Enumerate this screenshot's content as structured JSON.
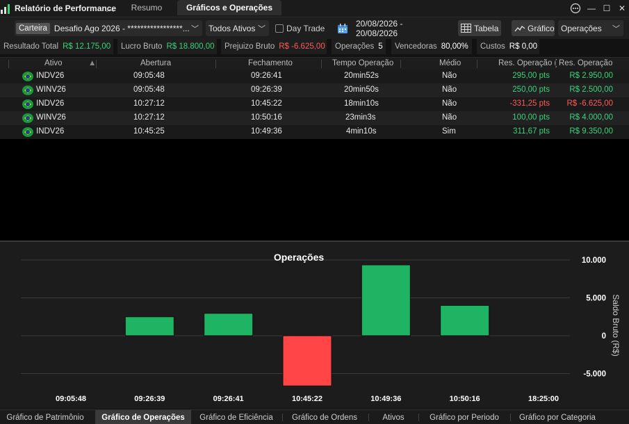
{
  "titlebar": {
    "app_title": "Relatório de Performance",
    "tabs": [
      {
        "label": "Resumo",
        "active": false
      },
      {
        "label": "Gráficos e Operações",
        "active": true
      }
    ],
    "menu_icon": "ellipsis-circle-icon",
    "minimize_icon": "minimize-icon",
    "maximize_icon": "maximize-icon",
    "close_icon": "close-icon"
  },
  "toolbar": {
    "carteira_label": "Carteira",
    "carteira_value": "Desafio Ago 2026 - *****************...",
    "ativos_value": "Todos Ativos",
    "daytrade_label": "Day Trade",
    "daytrade_checked": false,
    "date_range": "20/08/2026 - 20/08/2026",
    "tabela_label": "Tabela",
    "grafico_label": "Gráfico",
    "view_select_value": "Operações"
  },
  "stats": [
    {
      "label": "Resultado Total",
      "value": "R$ 12.175,00",
      "color": "#3dd17a"
    },
    {
      "label": "Lucro Bruto",
      "value": "R$ 18.800,00",
      "color": "#3dd17a"
    },
    {
      "label": "Prejuizo Bruto",
      "value": "R$ -6.625,00",
      "color": "#ff5a5a"
    },
    {
      "label": "Operações",
      "value": "5",
      "color": "#ffffff"
    },
    {
      "label": "Vencedoras",
      "value": "80,00%",
      "color": "#ffffff"
    },
    {
      "label": "Custos",
      "value": "R$ 0,00",
      "color": "#ffffff"
    }
  ],
  "table": {
    "headers": [
      "Ativo",
      "Abertura",
      "Fechamento",
      "Tempo Operação",
      "Médio",
      "Res. Operação (",
      "Res. Operação"
    ],
    "rows": [
      {
        "ativo": "INDV26",
        "abertura": "09:05:48",
        "fechamento": "09:26:41",
        "tempo": "20min52s",
        "medio": "Não",
        "res_pts": "295,00 pts",
        "res_brl": "R$ 2.950,00",
        "positive": true
      },
      {
        "ativo": "WINV26",
        "abertura": "09:05:48",
        "fechamento": "09:26:39",
        "tempo": "20min50s",
        "medio": "Não",
        "res_pts": "250,00 pts",
        "res_brl": "R$ 2.500,00",
        "positive": true
      },
      {
        "ativo": "INDV26",
        "abertura": "10:27:12",
        "fechamento": "10:45:22",
        "tempo": "18min10s",
        "medio": "Não",
        "res_pts": "-331,25 pts",
        "res_brl": "R$ -6.625,00",
        "positive": false
      },
      {
        "ativo": "WINV26",
        "abertura": "10:27:12",
        "fechamento": "10:50:16",
        "tempo": "23min3s",
        "medio": "Não",
        "res_pts": "100,00 pts",
        "res_brl": "R$ 4.000,00",
        "positive": true
      },
      {
        "ativo": "INDV26",
        "abertura": "10:45:25",
        "fechamento": "10:49:36",
        "tempo": "4min10s",
        "medio": "Sim",
        "res_pts": "311,67 pts",
        "res_brl": "R$ 9.350,00",
        "positive": true
      }
    ]
  },
  "chart_data": {
    "type": "bar",
    "title": "Operações",
    "ylabel": "Saldo Bruto (R$)",
    "xlabel": "",
    "x_tick_labels": [
      "09:05:48",
      "09:26:39",
      "09:26:41",
      "10:45:22",
      "10:49:36",
      "10:50:16",
      "18:25:00"
    ],
    "categories": [
      "09:26:39",
      "09:26:41",
      "10:45:22",
      "10:49:36",
      "10:50:16"
    ],
    "values": [
      2500,
      2950,
      -6625,
      9350,
      4000
    ],
    "y_tick_labels": [
      "10.000",
      "5.000",
      "0",
      "-5.000"
    ],
    "y_ticks": [
      10000,
      5000,
      0,
      -5000
    ],
    "ylim": [
      -6625,
      10000
    ],
    "positive_color": "#1fb463",
    "negative_color": "#ff4545",
    "grid": true
  },
  "bottom_tabs": [
    {
      "label": "Gráfico de Patrimônio",
      "active": false
    },
    {
      "label": "Gráfico de Operações",
      "active": true
    },
    {
      "label": "Gráfico de Eficiência",
      "active": false
    },
    {
      "label": "Gráfico de Ordens",
      "active": false
    },
    {
      "label": "Ativos",
      "active": false
    },
    {
      "label": "Gráfico por Periodo",
      "active": false
    },
    {
      "label": "Gráfico por Categoria",
      "active": false
    }
  ]
}
